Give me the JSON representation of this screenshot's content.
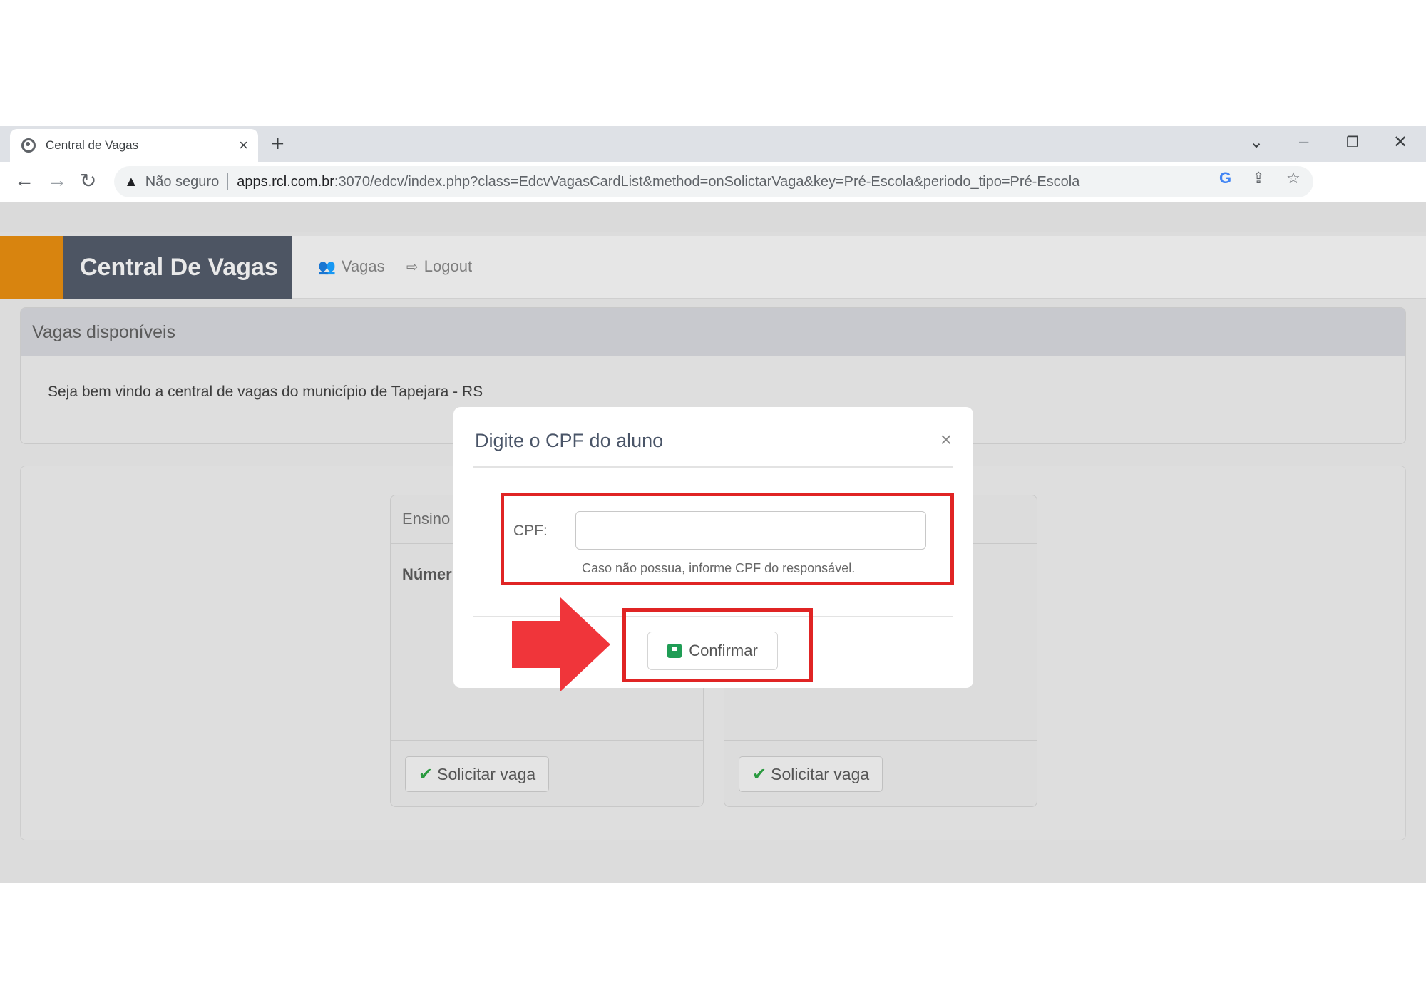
{
  "browser": {
    "tab_title": "Central de Vagas",
    "tab_close": "×",
    "new_tab": "+",
    "window_controls": {
      "tab_search": "⌄",
      "minimize": "–",
      "restore": "❐",
      "close": "✕"
    },
    "security_label": "Não seguro",
    "url_host": "apps.rcl.com.br",
    "url_rest": ":3070/edcv/index.php?class=EdcvVagasCardList&method=onSolictarVaga&key=Pré-Escola&periodo_tipo=Pré-Escola",
    "icons": [
      "back-icon",
      "forward-icon",
      "reload-icon",
      "warning-icon",
      "google-icon",
      "share-icon",
      "star-icon"
    ]
  },
  "navbar": {
    "brand": "Central De Vagas",
    "links": [
      {
        "label": "Vagas",
        "icon": "users-icon"
      },
      {
        "label": "Logout",
        "icon": "logout-icon"
      }
    ],
    "accent_color": "#d8840f",
    "brand_bg": "#4d5563"
  },
  "panel": {
    "header": "Vagas disponíveis",
    "welcome": "Seja bem vindo a central de vagas do município de Tapejara - RS"
  },
  "cards": [
    {
      "header": "Ensino",
      "body": "Númer",
      "button": "Solicitar vaga"
    },
    {
      "header": "",
      "body": "",
      "button": "Solicitar vaga"
    }
  ],
  "modal": {
    "title": "Digite o CPF do aluno",
    "close": "×",
    "cpf_label": "CPF:",
    "cpf_value": "",
    "hint": "Caso não possua, informe CPF do responsável.",
    "confirm_label": "Confirmar"
  },
  "annotation_color": "#e02424"
}
